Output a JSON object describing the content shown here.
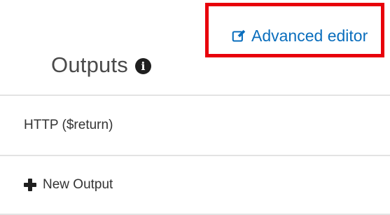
{
  "header": {
    "advanced_editor_label": "Advanced editor",
    "advanced_editor_icon": "edit-icon",
    "highlight_color": "#e8000b",
    "link_color": "#0a6ebd"
  },
  "outputs": {
    "title": "Outputs",
    "info_icon": "info-icon",
    "info_glyph": "i",
    "items": [
      {
        "label": "HTTP ($return)"
      }
    ],
    "new_output": {
      "label": "New Output",
      "icon": "plus-icon"
    }
  }
}
